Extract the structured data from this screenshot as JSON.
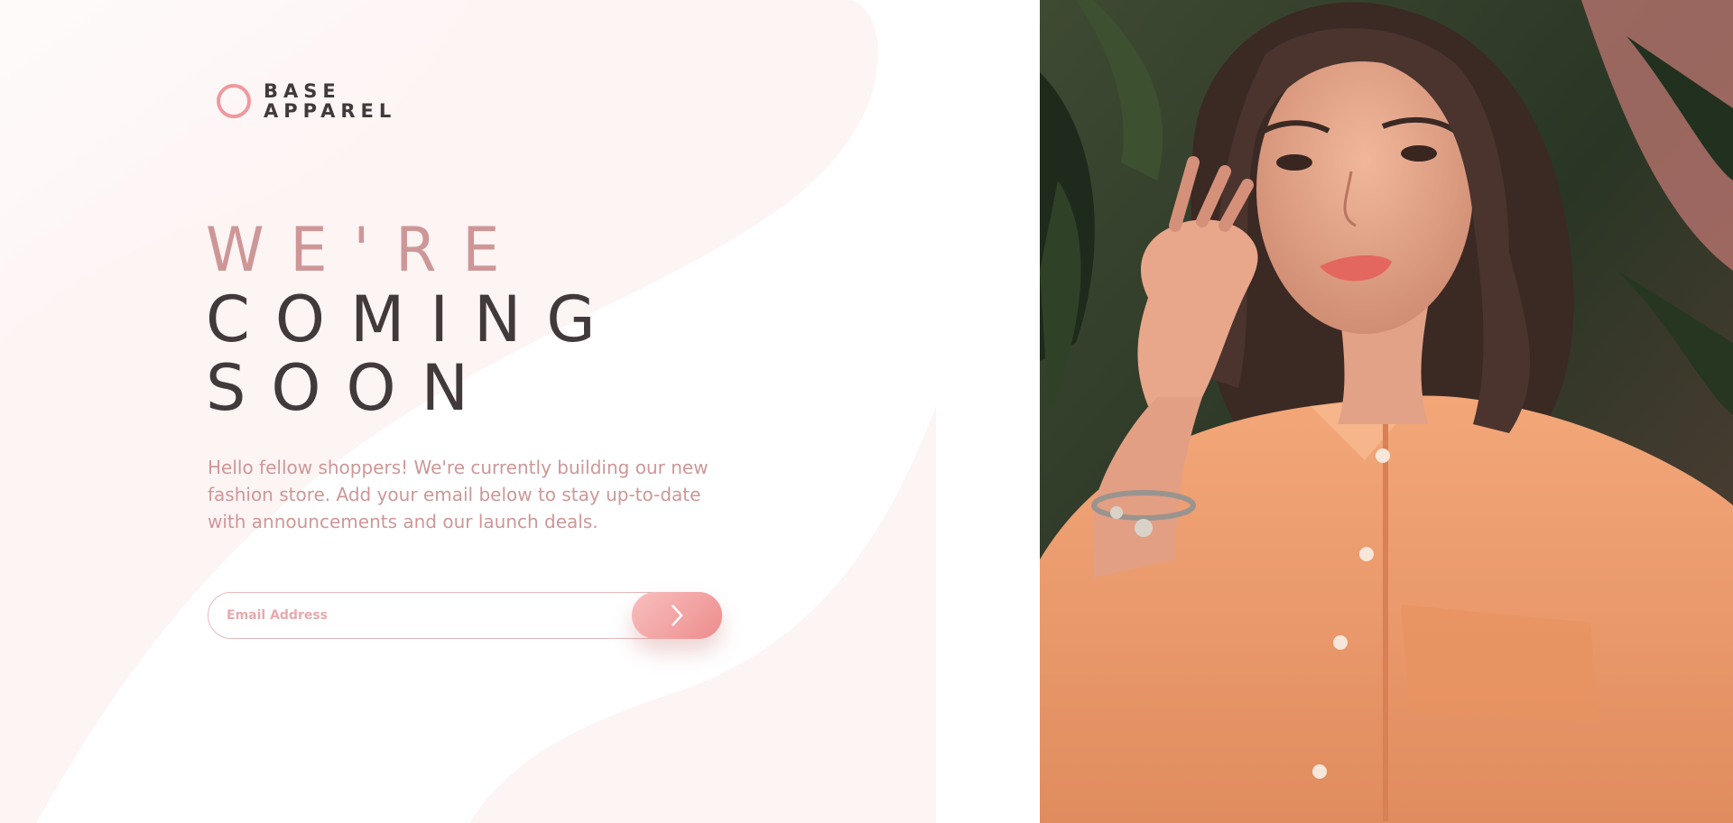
{
  "brand": {
    "line1": "BASE",
    "line2": "APPAREL",
    "accent_color": "#f0989e"
  },
  "headline": {
    "light": "WE'RE",
    "dark_line1": "COMING",
    "dark_line2": "SOON"
  },
  "intro": {
    "text": "Hello fellow shoppers! We're currently building our new fashion store. Add your email below to stay up-to-date with announcements and our launch deals."
  },
  "form": {
    "email_placeholder": "Email Address",
    "email_value": "",
    "submit_icon": "chevron-right-icon"
  },
  "colors": {
    "text_dark": "#423a3a",
    "text_rose": "#ce9797",
    "background": "#fdf3f2",
    "button_gradient_start": "#f8bfbf",
    "button_gradient_end": "#ee8c8c"
  },
  "hero": {
    "image_subject": "woman-in-orange-shirt-photo"
  }
}
